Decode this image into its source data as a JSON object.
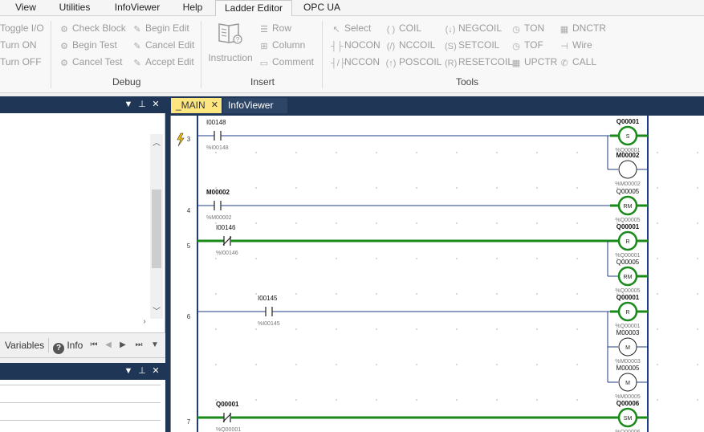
{
  "menu": {
    "items": [
      {
        "label": "View",
        "active": false
      },
      {
        "label": "Utilities",
        "active": false
      },
      {
        "label": "InfoViewer",
        "active": false
      },
      {
        "label": "Help",
        "active": false
      },
      {
        "label": "Ladder Editor",
        "active": true
      },
      {
        "label": "OPC UA",
        "active": false
      }
    ]
  },
  "ribbon": {
    "io_group": {
      "toggle_io": "Toggle I/O",
      "turn_on": "Turn ON",
      "turn_off": "Turn OFF"
    },
    "debug_group": {
      "label": "Debug",
      "check_block": "Check Block",
      "begin_edit": "Begin Edit",
      "begin_test": "Begin Test",
      "cancel_edit": "Cancel Edit",
      "cancel_test": "Cancel Test",
      "accept_edit": "Accept Edit"
    },
    "insert_group": {
      "label": "Insert",
      "instruction": "Instruction",
      "row": "Row",
      "column": "Column",
      "comment": "Comment"
    },
    "tools_group": {
      "label": "Tools",
      "select": "Select",
      "nocon": "NOCON",
      "nccon": "NCCON",
      "coil": "COIL",
      "nccoil": "NCCOIL",
      "poscoil": "POSCOIL",
      "negcoil": "NEGCOIL",
      "setcoil": "SETCOIL",
      "resetcoil": "RESETCOIL",
      "ton": "TON",
      "tof": "TOF",
      "upctr": "UPCTR",
      "dnctr": "DNCTR",
      "wire": "Wire",
      "call": "CALL"
    }
  },
  "left_panel": {
    "tabs": {
      "variables": "Variables",
      "info": "Info"
    }
  },
  "editor": {
    "tabs": [
      {
        "label": "_MAIN",
        "active": true
      },
      {
        "label": "InfoViewer",
        "active": false
      }
    ]
  },
  "ladder": {
    "rung_numbers": [
      "3",
      "4",
      "5",
      "6",
      "7"
    ],
    "contacts": [
      {
        "name": "I00148",
        "addr": "%I00148",
        "type": "NO",
        "powered": false
      },
      {
        "name": "M00002",
        "addr": "%M00002",
        "type": "NO",
        "powered": false
      },
      {
        "name": "I00146",
        "addr": "%I00146",
        "type": "NC",
        "powered": true
      },
      {
        "name": "I00145",
        "addr": "%I00145",
        "type": "NO",
        "powered": false
      },
      {
        "name": "Q00001",
        "addr": "%Q00001",
        "type": "NC",
        "powered": true
      }
    ],
    "coils": [
      {
        "name": "Q00001",
        "addr": "%Q00001",
        "symbol": "S",
        "powered": true
      },
      {
        "name": "M00002",
        "addr": "%M00002",
        "symbol": "",
        "powered": false
      },
      {
        "name": "Q00005",
        "addr": "%Q00005",
        "symbol": "RM",
        "powered": true
      },
      {
        "name": "Q00001",
        "addr": "%Q00001",
        "symbol": "R",
        "powered": true
      },
      {
        "name": "Q00005",
        "addr": "%Q00005",
        "symbol": "RM",
        "powered": true
      },
      {
        "name": "Q00001",
        "addr": "%Q00001",
        "symbol": "R",
        "powered": true
      },
      {
        "name": "M00003",
        "addr": "%M00003",
        "symbol": "M",
        "powered": false
      },
      {
        "name": "M00005",
        "addr": "%M00005",
        "symbol": "M",
        "powered": false
      },
      {
        "name": "Q00006",
        "addr": "%Q00006",
        "symbol": "SM",
        "powered": true
      }
    ]
  },
  "colors": {
    "dock_title": "#1f3656",
    "active_tab": "#fde680",
    "rail": "#1f3a8a",
    "powered": "#1a8a1a"
  }
}
